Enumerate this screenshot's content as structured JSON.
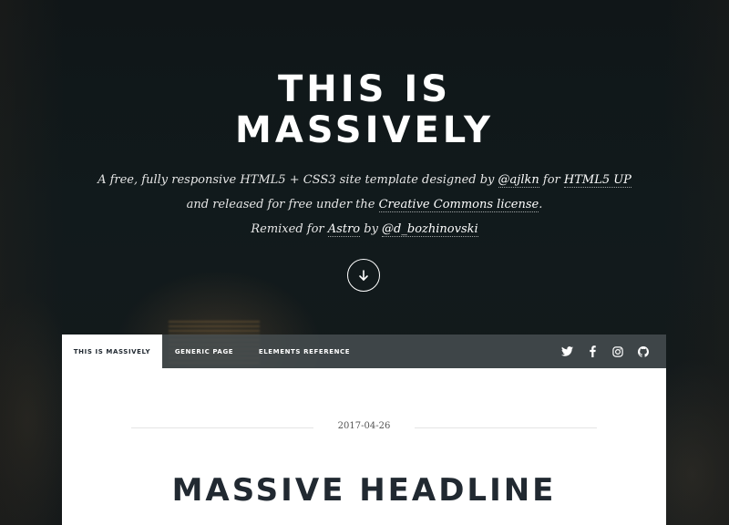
{
  "intro": {
    "title_line1": "THIS IS",
    "title_line2": "MASSIVELY",
    "desc_line1_pre": "A free, fully responsive HTML5 + CSS3 site template designed by ",
    "desc_line1_link1": "@ajlkn",
    "desc_line1_mid": " for ",
    "desc_line1_link2": "HTML5 UP",
    "desc_line2_pre": "and released for free under the ",
    "desc_line2_link": "Creative Commons license",
    "desc_line2_post": ".",
    "desc_line3_pre": "Remixed for ",
    "desc_line3_link1": "Astro",
    "desc_line3_mid": " by ",
    "desc_line3_link2": "@d_bozhinovski",
    "scroll_icon": "arrow-down-icon"
  },
  "nav": {
    "tabs": [
      {
        "label": "THIS IS MASSIVELY",
        "active": true
      },
      {
        "label": "GENERIC PAGE",
        "active": false
      },
      {
        "label": "ELEMENTS REFERENCE",
        "active": false
      }
    ],
    "social_icons": [
      "twitter-icon",
      "facebook-icon",
      "instagram-icon",
      "github-icon"
    ]
  },
  "main": {
    "date": "2017-04-26",
    "headline": "MASSIVE HEADLINE"
  },
  "colors": {
    "background": "#0f1416",
    "nav_bar": "#464e50",
    "headline_text": "#212931",
    "white": "#ffffff"
  }
}
